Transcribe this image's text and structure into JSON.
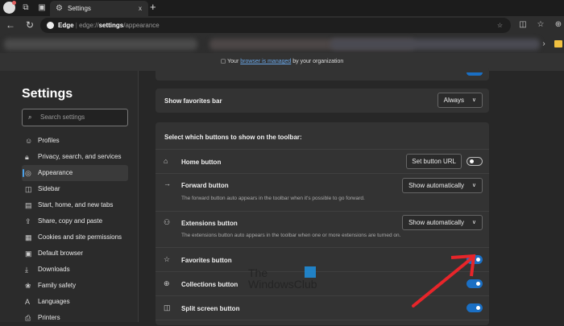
{
  "browser": {
    "tab_title": "Settings",
    "tab_close": "x",
    "new_tab": "+",
    "address_brand": "Edge",
    "url_prefix": "edge://",
    "url_bold": "settings",
    "url_suffix": "/appearance"
  },
  "banner": {
    "prefix": "Your",
    "link": "browser is managed",
    "suffix": "by your organization"
  },
  "sidebar": {
    "title": "Settings",
    "search_placeholder": "Search settings",
    "items": [
      {
        "label": "Profiles",
        "icon": "profile-icon"
      },
      {
        "label": "Privacy, search, and services",
        "icon": "lock-icon"
      },
      {
        "label": "Appearance",
        "icon": "palette-icon",
        "active": true
      },
      {
        "label": "Sidebar",
        "icon": "sidebar-icon"
      },
      {
        "label": "Start, home, and new tabs",
        "icon": "home-tabs-icon"
      },
      {
        "label": "Share, copy and paste",
        "icon": "share-icon"
      },
      {
        "label": "Cookies and site permissions",
        "icon": "cookie-icon"
      },
      {
        "label": "Default browser",
        "icon": "browser-icon"
      },
      {
        "label": "Downloads",
        "icon": "download-icon"
      },
      {
        "label": "Family safety",
        "icon": "family-icon"
      },
      {
        "label": "Languages",
        "icon": "language-icon"
      },
      {
        "label": "Printers",
        "icon": "printer-icon"
      }
    ]
  },
  "main": {
    "favorites_bar": {
      "label": "Show favorites bar",
      "value": "Always"
    },
    "toolbar_header": "Select which buttons to show on the toolbar:",
    "home": {
      "label": "Home button",
      "button": "Set button URL",
      "enabled": false
    },
    "forward": {
      "label": "Forward button",
      "desc": "The forward button auto appears in the toolbar when it's possible to go forward.",
      "value": "Show automatically"
    },
    "extensions": {
      "label": "Extensions button",
      "desc": "The extensions button auto appears in the toolbar when one or more extensions are turned on.",
      "value": "Show automatically"
    },
    "favorites": {
      "label": "Favorites button",
      "enabled": true
    },
    "collections": {
      "label": "Collections button",
      "enabled": true
    },
    "split": {
      "label": "Split screen button",
      "enabled": true
    }
  },
  "watermark": {
    "line1": "The",
    "line2": "WindowsClub"
  },
  "colors": {
    "accent": "#1a6fc4",
    "arrow": "#e8252a"
  }
}
